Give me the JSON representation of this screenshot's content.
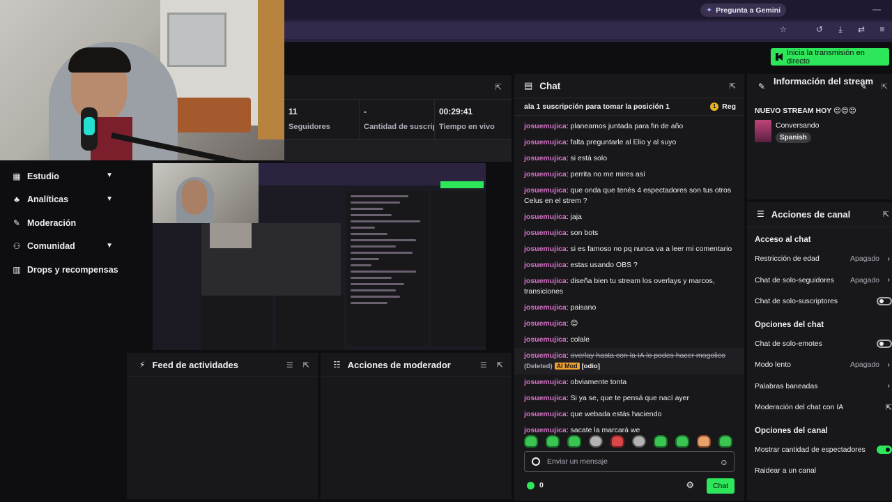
{
  "browser": {
    "gemini_label": "Pregunta a Gemini",
    "minimize": "—"
  },
  "header": {
    "go_live_label": "Inicia la transmisión en directo"
  },
  "nav": {
    "items": [
      {
        "label": "Estudio",
        "icon": "studio-icon",
        "expandable": true
      },
      {
        "label": "Analíticas",
        "icon": "analytics-icon",
        "expandable": true
      },
      {
        "label": "Moderación",
        "icon": "wrench-icon",
        "expandable": false
      },
      {
        "label": "Comunidad",
        "icon": "community-icon",
        "expandable": true
      },
      {
        "label": "Drops y recompensas",
        "icon": "drops-icon",
        "expandable": false
      }
    ]
  },
  "stats": {
    "followers_value": "11",
    "followers_label": "Seguidores",
    "subs_value": "-",
    "subs_label": "Cantidad de suscripciones",
    "uptime_value": "00:29:41",
    "uptime_label": "Tiempo en vivo"
  },
  "panels": {
    "feed_title": "Feed de actividades",
    "mod_title": "Acciones de moderador"
  },
  "chat": {
    "title": "Chat",
    "pinned": "ala 1 suscripción para tomar la posición 1",
    "pinned_action": "Reg",
    "messages": [
      {
        "user": "josuemujica",
        "text": "planeamos juntada para fin de año"
      },
      {
        "user": "josuemujica",
        "text": "falta preguntarle al Elio y al suyo"
      },
      {
        "user": "josuemujica",
        "text": "si está solo"
      },
      {
        "user": "josuemujica",
        "text": "perrita no me mires así"
      },
      {
        "user": "josuemujica",
        "text": "que onda que tenés 4 espectadores son tus otros Celus en el strem ?"
      },
      {
        "user": "josuemujica",
        "text": "jaja"
      },
      {
        "user": "josuemujica",
        "text": "son bots"
      },
      {
        "user": "josuemujica",
        "text": "si es famoso no pq nunca va a leer mi comentario"
      },
      {
        "user": "josuemujica",
        "text": "estas usando OBS ?"
      },
      {
        "user": "josuemujica",
        "text": "diseña bien tu stream los overlays y marcos, transiciones"
      },
      {
        "user": "josuemujica",
        "text": "paisano"
      },
      {
        "user": "josuemujica",
        "text": "😊"
      },
      {
        "user": "josuemujica",
        "text": "colale"
      },
      {
        "user": "josuemujica",
        "text": "overlay hasta con la IA lo podes hacer mogolico",
        "deleted": true,
        "deleted_tag": "(Deleted)",
        "ai_tag": "AI Mod",
        "reason_tag": "[odio]"
      },
      {
        "user": "josuemujica",
        "text": "obviamente tonta"
      },
      {
        "user": "josuemujica",
        "text": "Si ya se, que te pensá que nací ayer"
      },
      {
        "user": "josuemujica",
        "text": "que webada estás haciendo"
      },
      {
        "user": "josuemujica",
        "text": "sacate la marcará we"
      }
    ],
    "input_placeholder": "Enviar un mensaje",
    "points": "0",
    "send_label": "Chat"
  },
  "stream_info": {
    "title": "Información del stream",
    "stream_title": "NUEVO STREAM HOY 😍😍😍",
    "category": "Conversando",
    "tag": "Spanish"
  },
  "channel_actions": {
    "title": "Acciones de canal",
    "chat_access_header": "Acceso al chat",
    "age_restriction": "Restricción de edad",
    "age_restriction_value": "Apagado",
    "followers_only": "Chat de solo-seguidores",
    "followers_only_value": "Apagado",
    "subs_only": "Chat de solo-suscriptores",
    "chat_options_header": "Opciones del chat",
    "emote_only": "Chat de solo-emotes",
    "slow_mode": "Modo lento",
    "slow_mode_value": "Apagado",
    "banned_words": "Palabras baneadas",
    "ai_moderation": "Moderación del chat con IA",
    "channel_options_header": "Opciones del canal",
    "show_viewers": "Mostrar cantidad de espectadores",
    "raid": "Raidear a un canal"
  },
  "colors": {
    "accent": "#2ee65a",
    "username": "#d873c8",
    "panel": "#18181b",
    "background": "#0e0e10"
  }
}
